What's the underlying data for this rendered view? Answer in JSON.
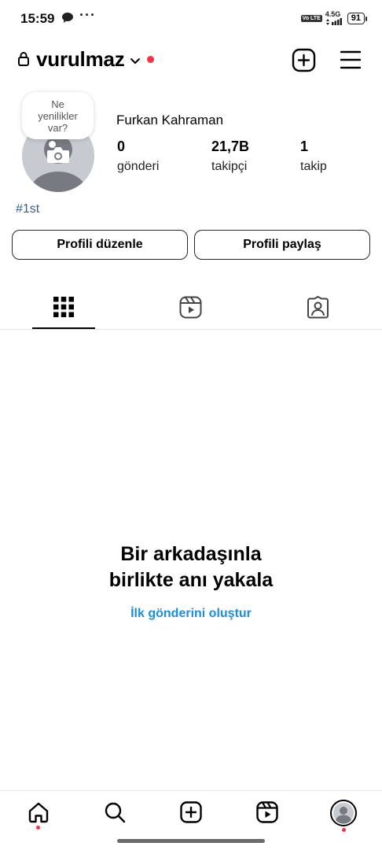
{
  "status_bar": {
    "time": "15:59",
    "network": "4.5G",
    "battery": "91",
    "volte": "Vo LTE",
    "icons": [
      "chat-bubble-icon",
      "more-dots-icon",
      "signal-icon",
      "battery-icon"
    ]
  },
  "header": {
    "username": "vurulmaz",
    "icons": [
      "lock-icon",
      "chevron-down-icon",
      "add-post-icon",
      "hamburger-menu-icon"
    ],
    "notification_color": "#ff2f40"
  },
  "profile": {
    "note_bubble": "Ne yenilikler var?",
    "full_name": "Furkan Kahraman",
    "stats": [
      {
        "value": "0",
        "label": "gönderi"
      },
      {
        "value": "21,7B",
        "label": "takipçi"
      },
      {
        "value": "1",
        "label": "takip"
      }
    ],
    "bio": "#1st"
  },
  "actions": {
    "edit_profile": "Profili düzenle",
    "share_profile": "Profili paylaş"
  },
  "tabs": [
    {
      "icon": "grid-icon",
      "active": true
    },
    {
      "icon": "reels-icon",
      "active": false
    },
    {
      "icon": "tagged-icon",
      "active": false
    }
  ],
  "empty_state": {
    "title_line1": "Bir arkadaşınla",
    "title_line2": "birlikte anı yakala",
    "link": "İlk gönderini oluştur",
    "link_color": "#1b8ee0"
  },
  "bottom_nav": [
    {
      "icon": "home-icon",
      "badge": true
    },
    {
      "icon": "search-icon",
      "badge": false
    },
    {
      "icon": "create-icon",
      "badge": false
    },
    {
      "icon": "reels-icon",
      "badge": false
    },
    {
      "icon": "profile-avatar-icon",
      "badge": true
    }
  ]
}
